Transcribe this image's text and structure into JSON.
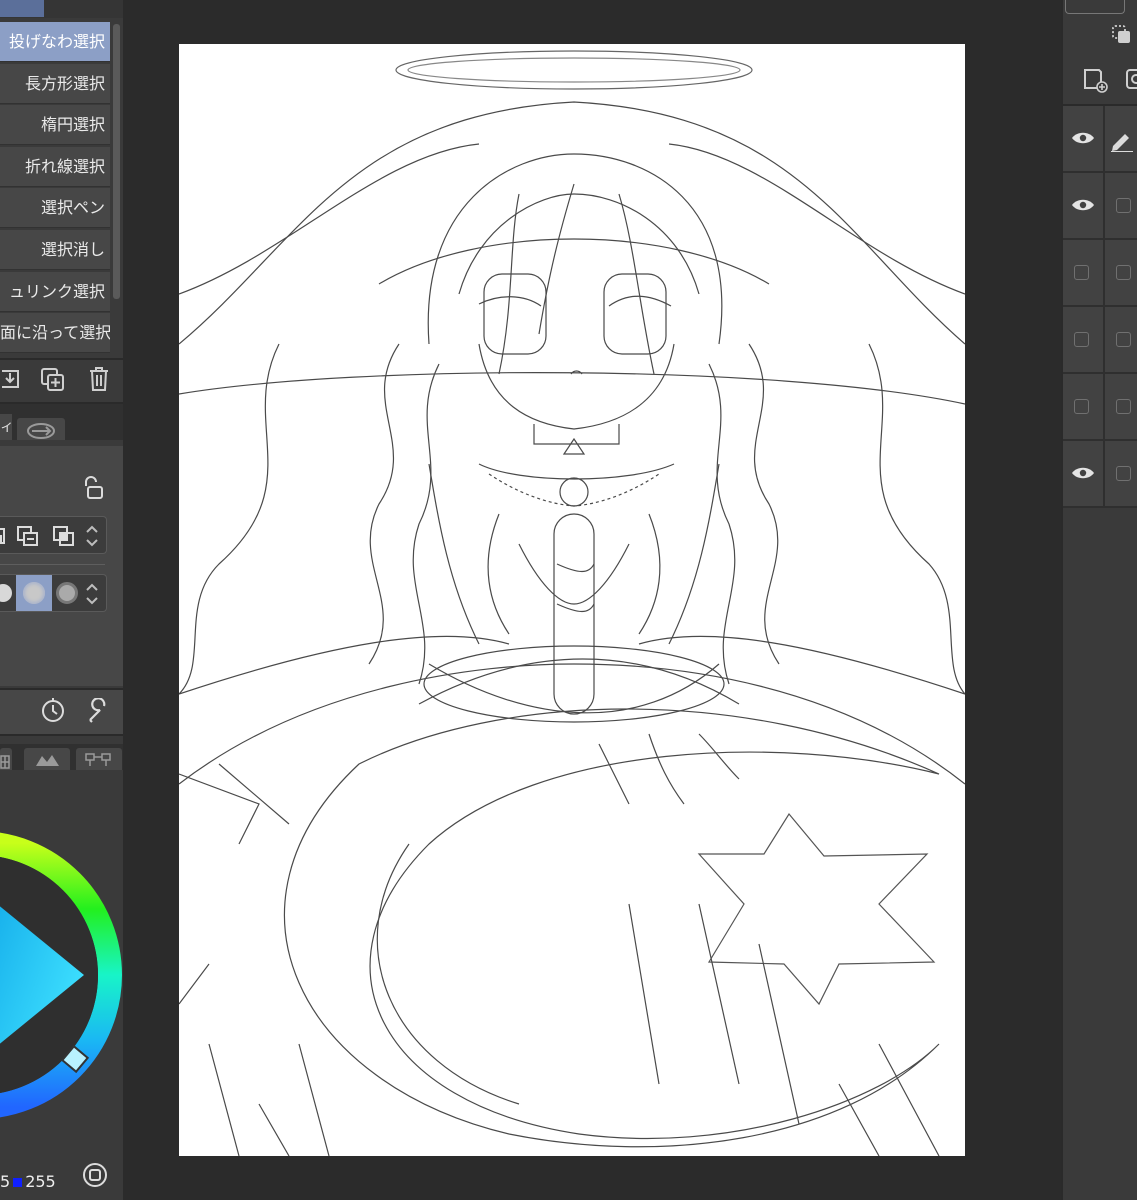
{
  "left_panel": {
    "selection_tools": [
      {
        "label": "投げなわ選択",
        "selected": true
      },
      {
        "label": "長方形選択",
        "selected": false
      },
      {
        "label": "楕円選択",
        "selected": false
      },
      {
        "label": "折れ線選択",
        "selected": false
      },
      {
        "label": "選択ペン",
        "selected": false
      },
      {
        "label": "選択消し",
        "selected": false
      },
      {
        "label": "ュリンク選択",
        "selected": false
      },
      {
        "label": "面に沿って選択",
        "selected": false
      }
    ],
    "tool_actions": [
      "duplicate-down-icon",
      "copy-add-icon",
      "trash-icon"
    ],
    "property_tab_label": "ィ",
    "color_values": {
      "prefix": "5",
      "blue": "255"
    },
    "accent_color": "#8c9fc6",
    "hue_ring_current_color": "#35c8d8"
  },
  "right_panel": {
    "layers": [
      {
        "visible": true,
        "icon": "pencil-icon"
      },
      {
        "visible": true,
        "icon": "checkbox"
      },
      {
        "visible": false,
        "icon": "checkbox"
      },
      {
        "visible": false,
        "icon": "checkbox"
      },
      {
        "visible": false,
        "icon": "checkbox"
      },
      {
        "visible": true,
        "icon": "checkbox"
      }
    ]
  },
  "canvas": {
    "background": "#ffffff",
    "content": "line-art-illustration"
  }
}
